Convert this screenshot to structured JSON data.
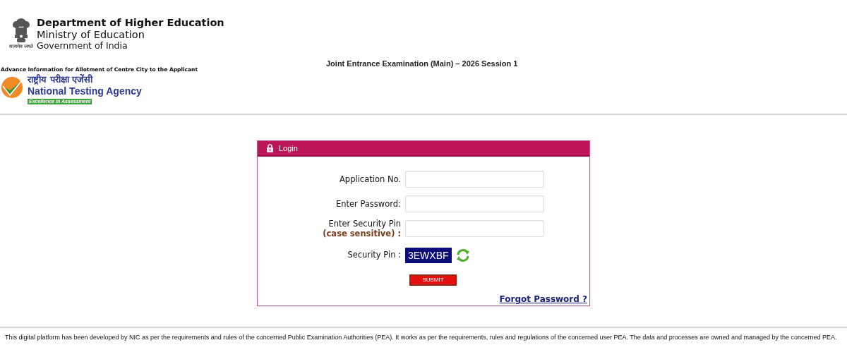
{
  "header": {
    "emblem_motto": "सत्यमेव जयते",
    "department": "Department of Higher Education",
    "ministry": "Ministry of Education",
    "government": "Government of India",
    "exam_title": "Joint Entrance Examination (Main) – 2026 Session 1",
    "subtitle": "Advance Information for Allotment of Centre City to the Applicant",
    "agency_hindi": "राष्ट्रीय परीक्षा एजेंसी",
    "agency": "National Testing Agency",
    "tagline": "Excellence in Assessment"
  },
  "login": {
    "title": "Login",
    "fields": [
      {
        "label": "Application No."
      },
      {
        "label": "Enter Password:"
      },
      {
        "label": "Enter Security Pin",
        "note": "(case sensitive) :"
      }
    ],
    "captcha_label": "Security Pin :",
    "captcha": "3EWXBF",
    "submit": "SUBMIT",
    "forgot": "Forgot Password ?"
  },
  "footer": "This digital platform has been developed by NIC as per the requirements and rules of the concerned Public Examination Authorities (PEA). It works as per the requirements, rules and regulations of the concerned user PEA. The data and processes are owned and managed by the concerned PEA."
}
